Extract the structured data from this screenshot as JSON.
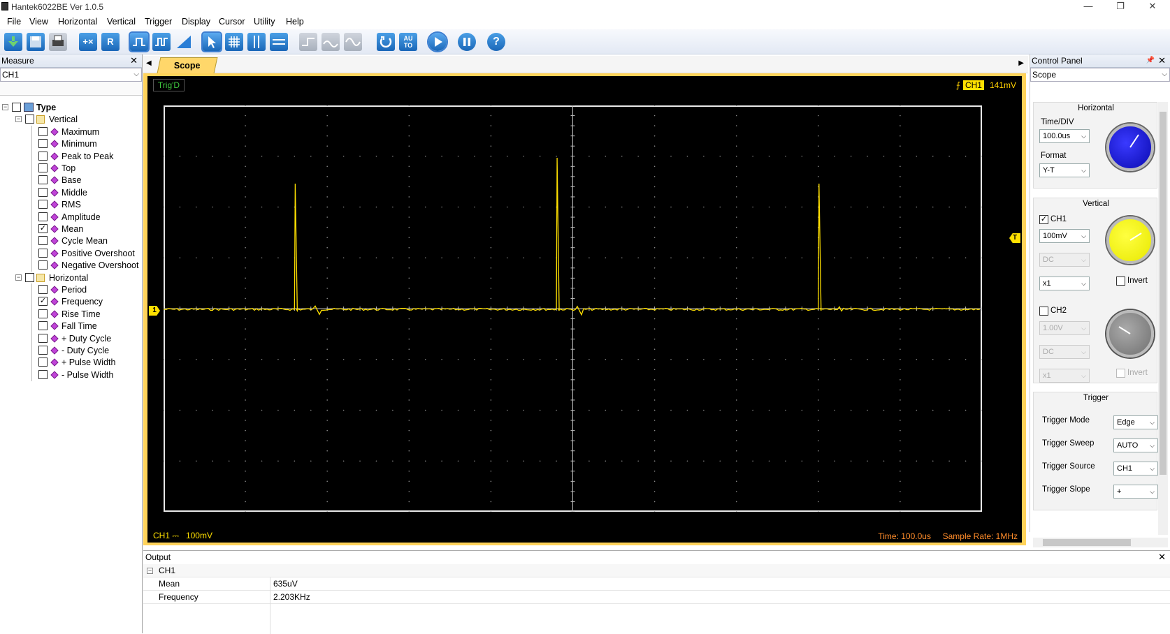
{
  "window": {
    "title": "Hantek6022BE Ver 1.0.5"
  },
  "menu": [
    "File",
    "View",
    "Horizontal",
    "Vertical",
    "Trigger",
    "Display",
    "Cursor",
    "Utility",
    "Help"
  ],
  "toolbar": {
    "buttons": [
      {
        "icon": "open-icon",
        "text": ""
      },
      {
        "icon": "save-icon",
        "text": ""
      },
      {
        "icon": "print-icon",
        "text": ""
      },
      {
        "icon": "math-icon",
        "text": "+×"
      },
      {
        "icon": "reference-icon",
        "text": "R"
      },
      {
        "icon": "ch1-wave-icon",
        "text": ""
      },
      {
        "icon": "ch2-wave-icon",
        "text": ""
      },
      {
        "icon": "ramp-icon",
        "text": ""
      },
      {
        "icon": "cursor-select-icon",
        "text": ""
      },
      {
        "icon": "grid-icon",
        "text": ""
      },
      {
        "icon": "vertical-cursor-icon",
        "text": ""
      },
      {
        "icon": "horizontal-cursor-icon",
        "text": ""
      },
      {
        "icon": "square-wave-icon",
        "text": ""
      },
      {
        "icon": "triangle-wave-icon",
        "text": ""
      },
      {
        "icon": "sine-wave-icon",
        "text": ""
      },
      {
        "icon": "single-icon",
        "text": ""
      },
      {
        "icon": "auto-icon",
        "text": "AU TO"
      },
      {
        "icon": "run-icon",
        "text": ""
      },
      {
        "icon": "pause-icon",
        "text": ""
      },
      {
        "icon": "help-icon",
        "text": "?"
      }
    ]
  },
  "measure": {
    "title": "Measure",
    "channel": "CH1",
    "root_label": "Type",
    "vertical_label": "Vertical",
    "vertical_items": [
      {
        "label": "Maximum",
        "checked": false
      },
      {
        "label": "Minimum",
        "checked": false
      },
      {
        "label": "Peak to Peak",
        "checked": false
      },
      {
        "label": "Top",
        "checked": false
      },
      {
        "label": "Base",
        "checked": false
      },
      {
        "label": "Middle",
        "checked": false
      },
      {
        "label": "RMS",
        "checked": false
      },
      {
        "label": "Amplitude",
        "checked": false
      },
      {
        "label": "Mean",
        "checked": true
      },
      {
        "label": "Cycle Mean",
        "checked": false
      },
      {
        "label": "Positive Overshoot",
        "checked": false
      },
      {
        "label": "Negative Overshoot",
        "checked": false
      }
    ],
    "horizontal_label": "Horizontal",
    "horizontal_items": [
      {
        "label": "Period",
        "checked": false
      },
      {
        "label": "Frequency",
        "checked": true
      },
      {
        "label": "Rise Time",
        "checked": false
      },
      {
        "label": "Fall Time",
        "checked": false
      },
      {
        "label": "+ Duty Cycle",
        "checked": false
      },
      {
        "label": "- Duty Cycle",
        "checked": false
      },
      {
        "label": "+ Pulse Width",
        "checked": false
      },
      {
        "label": "- Pulse Width",
        "checked": false
      }
    ]
  },
  "scope": {
    "tab_label": "Scope",
    "trig_status": "Trig'D",
    "trig_channel": "CH1",
    "trig_level": "141mV",
    "ch1_marker": "1",
    "trig_marker": "T",
    "bottom_channel": "CH1",
    "bottom_coupling": "⎓",
    "bottom_volts": "100mV",
    "time_label": "Time: 100.0us",
    "sample_rate_label": "Sample Rate: 1MHz",
    "trace_color": "#ffe000",
    "pulse_positions_ms": [
      0.16,
      0.48,
      0.8
    ]
  },
  "control": {
    "title": "Control Panel",
    "mode": "Scope",
    "horizontal": {
      "title": "Horizontal",
      "timediv_label": "Time/DIV",
      "timediv": "100.0us",
      "format_label": "Format",
      "format": "Y-T"
    },
    "vertical": {
      "title": "Vertical",
      "ch1_label": "CH1",
      "ch1_enabled": true,
      "ch1_volts": "100mV",
      "ch1_coupling": "DC",
      "ch1_probe": "x1",
      "ch1_invert_label": "Invert",
      "ch2_label": "CH2",
      "ch2_enabled": false,
      "ch2_volts": "1.00V",
      "ch2_coupling": "DC",
      "ch2_probe": "x1",
      "ch2_invert_label": "Invert"
    },
    "trigger": {
      "title": "Trigger",
      "mode_label": "Trigger Mode",
      "mode": "Edge",
      "sweep_label": "Trigger Sweep",
      "sweep": "AUTO",
      "source_label": "Trigger Source",
      "source": "CH1",
      "slope_label": "Trigger Slope",
      "slope": "+"
    }
  },
  "output": {
    "title": "Output",
    "channel": "CH1",
    "rows": [
      {
        "name": "Mean",
        "value": "635uV"
      },
      {
        "name": "Frequency",
        "value": "2.203KHz"
      }
    ]
  }
}
